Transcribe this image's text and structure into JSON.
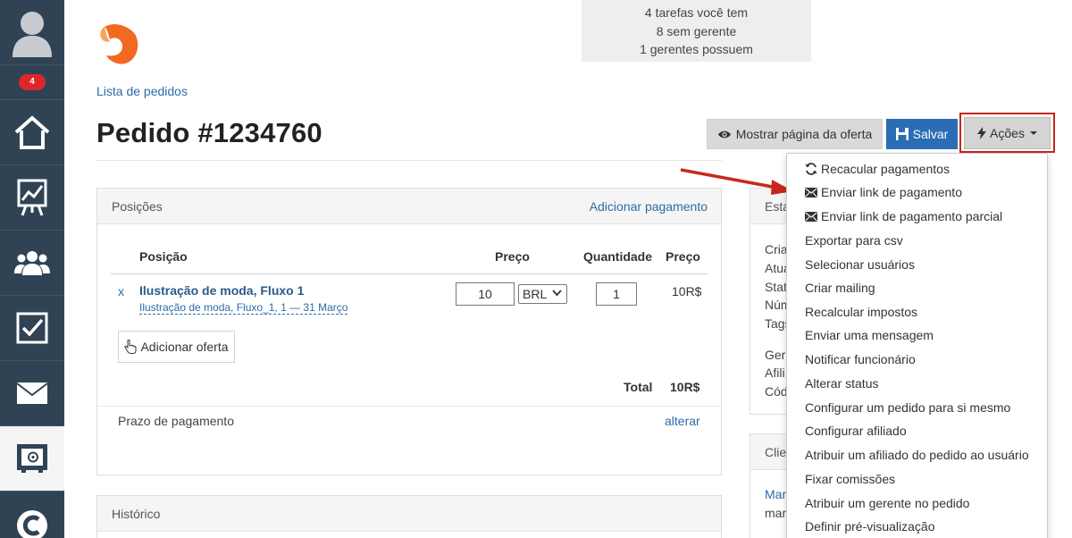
{
  "sidebar": {
    "badge_count": "4",
    "items": [
      {
        "name": "home-icon"
      },
      {
        "name": "chart-icon"
      },
      {
        "name": "users-icon"
      },
      {
        "name": "checkbox-icon"
      },
      {
        "name": "mail-icon"
      },
      {
        "name": "safe-icon"
      },
      {
        "name": "c-logo-icon"
      }
    ]
  },
  "info": {
    "line1": "4 tarefas você tem",
    "line2": "8 sem gerente",
    "line3": "1 gerentes possuem"
  },
  "breadcrumb": "Lista de pedidos",
  "page_title": "Pedido #1234760",
  "toolbar": {
    "show_offer_label": "Mostrar página da oferta",
    "save_label": "Salvar",
    "actions_label": "Ações"
  },
  "positions_panel": {
    "title": "Posições",
    "add_payment": "Adicionar pagamento",
    "columns": {
      "position": "Posição",
      "price": "Preço",
      "quantity": "Quantidade",
      "price2": "Preço"
    },
    "row": {
      "remove": "x",
      "name": "Ilustração de moda, Fluxo 1",
      "sub": "Ilustração de moda, Fluxo_1, 1 — 31 Março",
      "price_value": "10",
      "currency": "BRL",
      "quantity": "1",
      "line_price": "10R$"
    },
    "add_offer": "Adicionar oferta",
    "total_label": "Total",
    "total_value": "10R$",
    "payment_term_label": "Prazo de pagamento",
    "payment_term_action": "alterar"
  },
  "history_panel": {
    "title": "Histórico"
  },
  "right_panel": {
    "head1": "Esta",
    "rows": [
      "Cria",
      "Atua",
      "Stat",
      "Núm",
      "Tags"
    ],
    "rows2": [
      "Gere",
      "Afili",
      "Cód"
    ],
    "head2": "Clie",
    "client_link": "Mar",
    "client_text": "mar"
  },
  "actions_menu": [
    {
      "label": "Recacular pagamentos",
      "icon": "refresh-icon"
    },
    {
      "label": "Enviar link de pagamento",
      "icon": "envelope-icon"
    },
    {
      "label": "Enviar link de pagamento parcial",
      "icon": "envelope-icon"
    },
    {
      "label": "Exportar para csv",
      "icon": ""
    },
    {
      "label": "Selecionar usuários",
      "icon": ""
    },
    {
      "label": "Criar mailing",
      "icon": ""
    },
    {
      "label": "Recalcular impostos",
      "icon": ""
    },
    {
      "label": "Enviar uma mensagem",
      "icon": ""
    },
    {
      "label": "Notificar funcionário",
      "icon": ""
    },
    {
      "label": "Alterar status",
      "icon": ""
    },
    {
      "label": "Configurar um pedido para si mesmo",
      "icon": ""
    },
    {
      "label": "Configurar afiliado",
      "icon": ""
    },
    {
      "label": "Atribuir um afiliado do pedido ao usuário",
      "icon": ""
    },
    {
      "label": "Fixar comissões",
      "icon": ""
    },
    {
      "label": "Atribuir um gerente no pedido",
      "icon": ""
    },
    {
      "label": "Definir pré-visualização",
      "icon": ""
    }
  ],
  "colors": {
    "sidebar": "#2f4355",
    "primary": "#2a6db5",
    "link": "#2d6ca8",
    "highlight_red": "#c9271d",
    "badge_red": "#e0262d"
  }
}
